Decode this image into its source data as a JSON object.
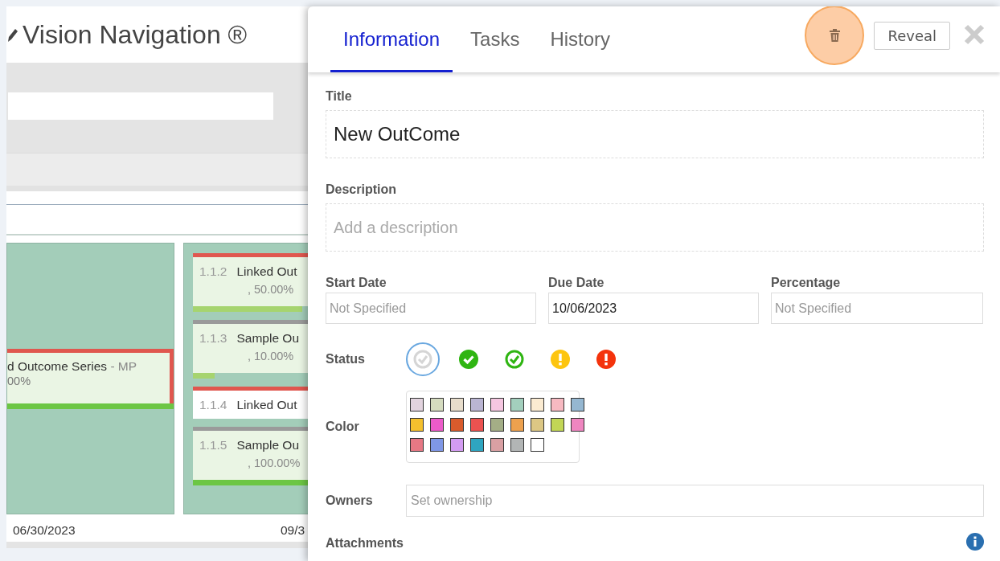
{
  "app": {
    "title": "Vision Navigation ®",
    "series_card": {
      "title": "d Outcome Series",
      "owner": "- MP",
      "percent": "00%",
      "level": 1,
      "color": "#e0574f"
    },
    "outcomes": [
      {
        "number": "1.1.2",
        "title": "Linked Out",
        "percent": ", 50.00%",
        "level": 0.5,
        "color": "#e0574f"
      },
      {
        "number": "1.1.3",
        "title": "Sample Ou",
        "percent": ", 10.00%",
        "level": 0.1,
        "color": "#9a9a9a"
      },
      {
        "number": "1.1.4",
        "title": "Linked Out",
        "color": "#e0574f"
      },
      {
        "number": "1.1.5",
        "title": "Sample Ou",
        "percent": ", 100.00%",
        "level": 1,
        "color": "#9a9a9a"
      }
    ],
    "dates": [
      "06/30/2023",
      "09/3"
    ]
  },
  "drawer": {
    "tabs": [
      {
        "label": "Information",
        "selected": true
      },
      {
        "label": "Tasks",
        "selected": false
      },
      {
        "label": "History",
        "selected": false
      }
    ],
    "reveal_button": "Reveal",
    "title": {
      "label": "Title",
      "value": "New OutCome"
    },
    "description": {
      "label": "Description",
      "placeholder": "Add a description"
    },
    "dates": [
      {
        "label": "Start Date",
        "placeholder": "Not Specified"
      },
      {
        "label": "Due Date",
        "value": "10/06/2023"
      },
      {
        "label": "Percentage",
        "placeholder": "Not Specified"
      }
    ],
    "status": {
      "label": "Status",
      "options": [
        {
          "kind": "none",
          "selected": true
        },
        {
          "kind": "done",
          "selected": false
        },
        {
          "kind": "on-track",
          "selected": false
        },
        {
          "kind": "warning",
          "selected": false
        },
        {
          "kind": "alert",
          "selected": false
        }
      ]
    },
    "color": {
      "label": "Color",
      "swatches": [
        {
          "color": "#e2d3de"
        },
        {
          "color": "#d5dbbf"
        },
        {
          "color": "#e8ddcb"
        },
        {
          "color": "#bab5d3"
        },
        {
          "color": "#f5c6e0"
        },
        {
          "color": "#a3cfbd"
        },
        {
          "color": "#fbebd1"
        },
        {
          "color": "#f7b9c1"
        },
        {
          "color": "#95b7d1"
        },
        {
          "color": "#f4c02e"
        },
        {
          "color": "#ec5bc9"
        },
        {
          "color": "#d95b2c"
        },
        {
          "color": "#ec5250"
        },
        {
          "color": "#a4ae86"
        },
        {
          "color": "#eda14e"
        },
        {
          "color": "#dcc784"
        },
        {
          "color": "#c2d656"
        },
        {
          "color": "#ef86c0"
        },
        {
          "color": "#e67884"
        },
        {
          "color": "#7f97e6"
        },
        {
          "color": "#d39cf2"
        },
        {
          "color": "#2fa5c0"
        },
        {
          "color": "#d9a0a3"
        },
        {
          "color": "#b2b5b5"
        },
        {
          "color": "#ffffff"
        }
      ]
    },
    "owners": {
      "label": "Owners",
      "placeholder": "Set ownership"
    },
    "attachments": {
      "label": "Attachments"
    }
  }
}
